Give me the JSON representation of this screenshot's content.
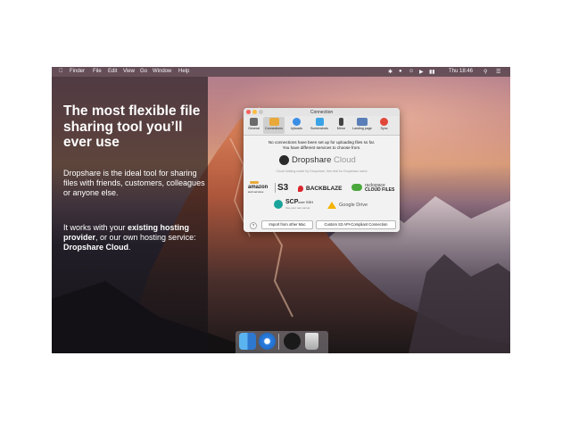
{
  "menubar": {
    "apple_icon": "apple-icon",
    "items": [
      "Finder",
      "File",
      "Edit",
      "View",
      "Go",
      "Window",
      "Help"
    ],
    "clock": "Thu 18:46"
  },
  "marketing": {
    "headline": "The most flexible file sharing tool you’ll ever use",
    "para1": "Dropshare is the ideal tool for sharing files with friends, customers, colleagues or anyone else.",
    "para2_prefix": "It works with your ",
    "para2_bold1": "existing hosting provider",
    "para2_middle": ", or our own hosting service: ",
    "para2_bold2": "Dropshare Cloud",
    "para2_suffix": "."
  },
  "window": {
    "title": "Connection",
    "toolbar": [
      {
        "label": "General",
        "icon": "sliders-icon",
        "color": "#6b6b6b"
      },
      {
        "label": "Connections",
        "icon": "cloud-server-icon",
        "color": "#e8a93a"
      },
      {
        "label": "Uploads",
        "icon": "upload-cloud-icon",
        "color": "#3a8ee6"
      },
      {
        "label": "Screenshots",
        "icon": "screenshot-icon",
        "color": "#3aa3e6"
      },
      {
        "label": "Mirror",
        "icon": "phone-icon",
        "color": "#444444"
      },
      {
        "label": "Landing page",
        "icon": "landing-page-icon",
        "color": "#5a7fb8"
      },
      {
        "label": "Sync",
        "icon": "sync-icon",
        "color": "#e0483a"
      }
    ],
    "message_line1": "No connections have been set up for uploading files so far.",
    "message_line2": "You have different services to choose from.",
    "cloud_name_bold": "Dropshare",
    "cloud_name_light": " Cloud",
    "cloud_sub": "Cloud hosting made by Dropshare, free trial for Dropshare users",
    "providers": {
      "amazon_line1": "amazon",
      "amazon_line2": "web services",
      "s3": "S3",
      "backblaze": "BACKBLAZE",
      "rackspace_line1": "rackspace",
      "rackspace_line2": "CLOUD FILES",
      "scp": "SCP",
      "scp_over": "over SSH",
      "scp_sub": "Use your own server",
      "google": "Google",
      "drive": " Drive"
    },
    "btn_import": "Import from other Mac",
    "btn_custom": "Custom S3 API-Compliant Connection",
    "help": "?"
  },
  "colors": {
    "accent": "#e8a93a",
    "backblaze_red": "#d9272e",
    "rackspace_green": "#4aa83b",
    "scp_teal": "#1aa39a"
  }
}
